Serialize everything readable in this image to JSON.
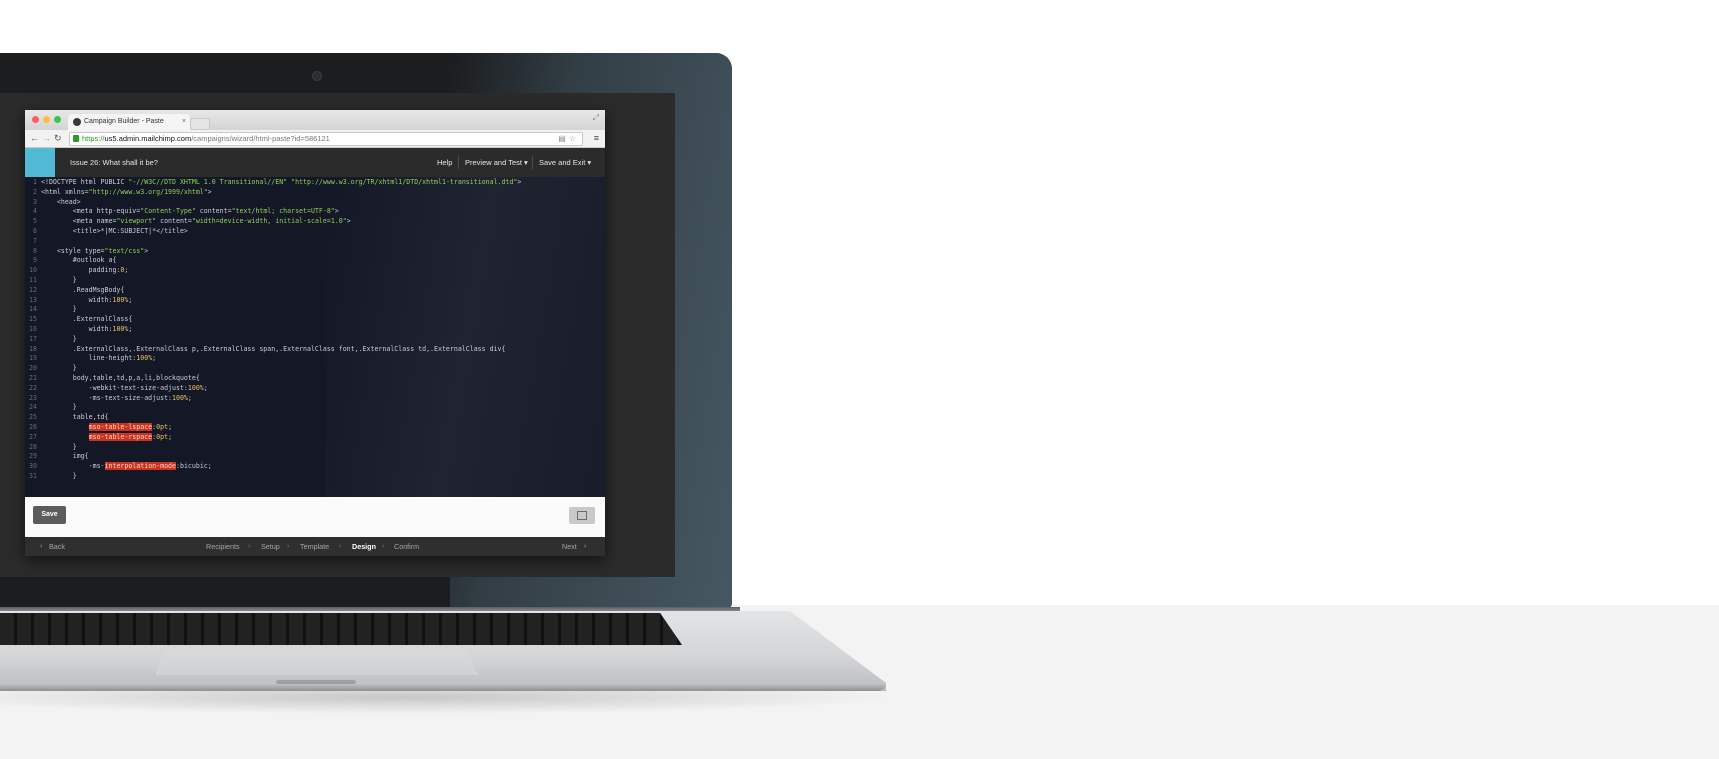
{
  "browser": {
    "tab_title": "Campaign Builder - Paste",
    "tab_close": "×",
    "url": {
      "scheme": "https://",
      "host": "us5.admin.mailchimp.com",
      "path": "/campaigns/wizard/html-paste?id=586121"
    },
    "icons": [
      "back-icon",
      "forward-icon",
      "reload-icon",
      "lock-icon",
      "page-icon",
      "star-icon",
      "menu-icon"
    ]
  },
  "header": {
    "campaign_title": "Issue 26: What shall it be?",
    "help": "Help",
    "preview": "Preview and Test ▾",
    "save_exit": "Save and Exit ▾"
  },
  "editor": {
    "lines": [
      {
        "n": "1",
        "t": "<!DOCTYPE html PUBLIC \"-//W3C//DTD XHTML 1.0 Transitional//EN\" \"http://www.w3.org/TR/xhtml1/DTD/xhtml1-transitional.dtd\">"
      },
      {
        "n": "2",
        "t": "<html xmlns=\"http://www.w3.org/1999/xhtml\">"
      },
      {
        "n": "3",
        "t": "    <head>"
      },
      {
        "n": "4",
        "t": "        <meta http-equiv=\"Content-Type\" content=\"text/html; charset=UTF-8\">"
      },
      {
        "n": "5",
        "t": "        <meta name=\"viewport\" content=\"width=device-width, initial-scale=1.0\">"
      },
      {
        "n": "6",
        "t": "        <title>*|MC:SUBJECT|*</title>"
      },
      {
        "n": "7",
        "t": ""
      },
      {
        "n": "8",
        "t": "    <style type=\"text/css\">"
      },
      {
        "n": "9",
        "t": "        #outlook a{"
      },
      {
        "n": "10",
        "t": "            padding:0;"
      },
      {
        "n": "11",
        "t": "        }"
      },
      {
        "n": "12",
        "t": "        .ReadMsgBody{"
      },
      {
        "n": "13",
        "t": "            width:100%;"
      },
      {
        "n": "14",
        "t": "        }"
      },
      {
        "n": "15",
        "t": "        .ExternalClass{"
      },
      {
        "n": "16",
        "t": "            width:100%;"
      },
      {
        "n": "17",
        "t": "        }"
      },
      {
        "n": "18",
        "t": "        .ExternalClass,.ExternalClass p,.ExternalClass span,.ExternalClass font,.ExternalClass td,.ExternalClass div{"
      },
      {
        "n": "19",
        "t": "            line-height:100%;"
      },
      {
        "n": "20",
        "t": "        }"
      },
      {
        "n": "21",
        "t": "        body,table,td,p,a,li,blockquote{"
      },
      {
        "n": "22",
        "t": "            -webkit-text-size-adjust:100%;"
      },
      {
        "n": "23",
        "t": "            -ms-text-size-adjust:100%;"
      },
      {
        "n": "24",
        "t": "        }"
      },
      {
        "n": "25",
        "t": "        table,td{"
      },
      {
        "n": "26",
        "t": "            mso-table-lspace:0pt;"
      },
      {
        "n": "27",
        "t": "            mso-table-rspace:0pt;"
      },
      {
        "n": "28",
        "t": "        }"
      },
      {
        "n": "29",
        "t": "        img{"
      },
      {
        "n": "30",
        "t": "            -ms-interpolation-mode:bicubic;"
      },
      {
        "n": "31",
        "t": "        }"
      }
    ]
  },
  "savebar": {
    "save": "Save"
  },
  "footer": {
    "back": "Back",
    "steps": [
      "Recipients",
      "Setup",
      "Template",
      "Design",
      "Confirm"
    ],
    "active_step": "Design",
    "next": "Next"
  },
  "colors": {
    "brand": "#52bad5",
    "editor_bg": "#141826",
    "highlight": "#c8321f",
    "string": "#8fcf5a"
  }
}
